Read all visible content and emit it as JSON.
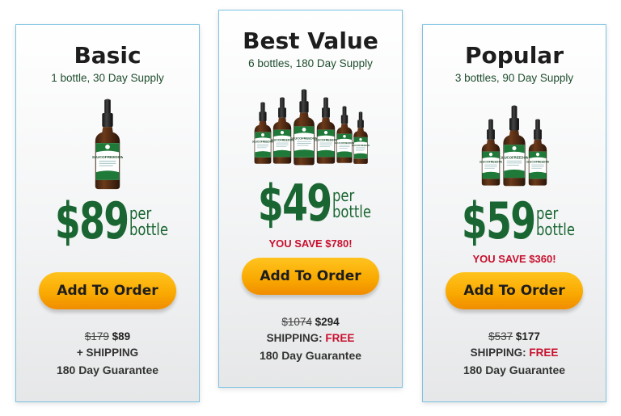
{
  "colors": {
    "accent_green": "#1a6632",
    "save_red": "#c8102e",
    "button_orange": "#f9a800",
    "border_blue": "#7cc3e3"
  },
  "product": {
    "label": "GLUCOFREEDOM"
  },
  "cards": [
    {
      "title": "Basic",
      "supply": "1 bottle, 30 Day Supply",
      "bottle_count": 1,
      "price": "$89",
      "per_line1": "per",
      "per_line2": "bottle",
      "save": "",
      "button": "Add To Order",
      "old_price": "$179",
      "new_price": "$89",
      "shipping_label": "+ SHIPPING",
      "shipping_value": "",
      "guarantee": "180 Day Guarantee"
    },
    {
      "title": "Best Value",
      "supply": "6 bottles, 180 Day Supply",
      "bottle_count": 6,
      "price": "$49",
      "per_line1": "per",
      "per_line2": "bottle",
      "save": "YOU SAVE $780!",
      "button": "Add To Order",
      "old_price": "$1074",
      "new_price": "$294",
      "shipping_label": "SHIPPING:",
      "shipping_value": "FREE",
      "guarantee": "180 Day Guarantee"
    },
    {
      "title": "Popular",
      "supply": "3 bottles, 90 Day Supply",
      "bottle_count": 3,
      "price": "$59",
      "per_line1": "per",
      "per_line2": "bottle",
      "save": "YOU SAVE $360!",
      "button": "Add To Order",
      "old_price": "$537",
      "new_price": "$177",
      "shipping_label": "SHIPPING:",
      "shipping_value": "FREE",
      "guarantee": "180 Day Guarantee"
    }
  ]
}
